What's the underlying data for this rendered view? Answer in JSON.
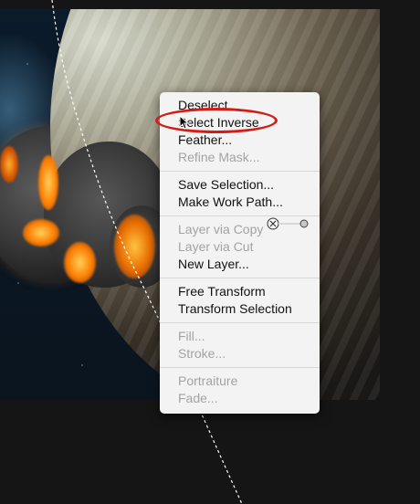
{
  "context_menu": {
    "groups": [
      [
        {
          "label": "Deselect",
          "enabled": true
        },
        {
          "label": "Select Inverse",
          "enabled": true
        },
        {
          "label": "Feather...",
          "enabled": true
        },
        {
          "label": "Refine Mask...",
          "enabled": false
        }
      ],
      [
        {
          "label": "Save Selection...",
          "enabled": true
        },
        {
          "label": "Make Work Path...",
          "enabled": true
        }
      ],
      [
        {
          "label": "Layer via Copy",
          "enabled": false
        },
        {
          "label": "Layer via Cut",
          "enabled": false
        },
        {
          "label": "New Layer...",
          "enabled": true
        }
      ],
      [
        {
          "label": "Free Transform",
          "enabled": true
        },
        {
          "label": "Transform Selection",
          "enabled": true
        }
      ],
      [
        {
          "label": "Fill...",
          "enabled": false
        },
        {
          "label": "Stroke...",
          "enabled": false
        }
      ],
      [
        {
          "label": "Portraiture",
          "enabled": false
        },
        {
          "label": "Fade...",
          "enabled": false
        }
      ]
    ],
    "highlighted_item": "Select Inverse"
  },
  "colors": {
    "highlight_ring": "#d41c16",
    "menu_background": "#f3f3f3",
    "enabled_text": "#111111",
    "disabled_text": "#a3a3a3"
  },
  "icons": {
    "pointer": "arrow-cursor-icon",
    "drag": "copy-cursor-icon"
  }
}
